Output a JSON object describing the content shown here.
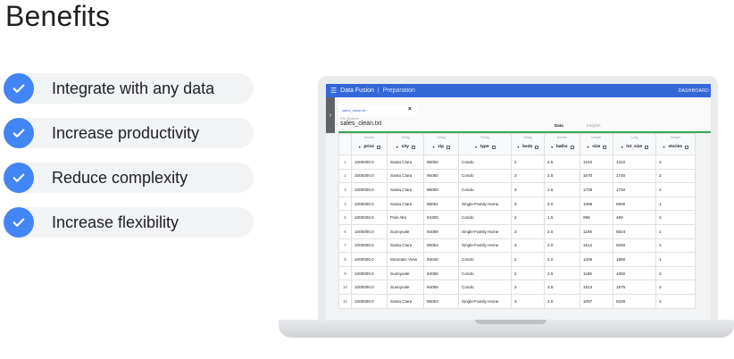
{
  "slide": {
    "title": "Benefits",
    "bullets": [
      "Integrate with any data",
      "Increase productivity",
      "Reduce complexity",
      "Increase flexibility"
    ],
    "bullet_icon": "check-icon",
    "colors": {
      "check": "#4285f4",
      "pill": "#f1f3f4"
    }
  },
  "app": {
    "name": "Data Fusion",
    "section": "Preparation",
    "dashboard_label": "DASHBOARD",
    "file_tab": "sales_clean.txt",
    "source": "File System",
    "dataset": "sales_clean.txt",
    "view_tabs": [
      "Data",
      "Insights"
    ],
    "active_view": "Data",
    "colors": {
      "topbar": "#3367d6",
      "accent_line": "#34a853"
    }
  },
  "table": {
    "columns": [
      {
        "type": "Double",
        "name": "price"
      },
      {
        "type": "String",
        "name": "city"
      },
      {
        "type": "String",
        "name": "zip"
      },
      {
        "type": "String",
        "name": "type"
      },
      {
        "type": "String",
        "name": "beds"
      },
      {
        "type": "Double",
        "name": "baths"
      },
      {
        "type": "Integer",
        "name": "size"
      },
      {
        "type": "Long",
        "name": "lot_size"
      },
      {
        "type": "Integer",
        "name": "stories"
      }
    ],
    "rows": [
      [
        "1",
        "1000000.0",
        "Santa Clara",
        "95050",
        "Condo",
        "2",
        "2.5",
        "1410",
        "1422",
        "3"
      ],
      [
        "2",
        "1000000.0",
        "Santa Clara",
        "95050",
        "Condo",
        "3",
        "2.5",
        "1670",
        "1740",
        "2"
      ],
      [
        "3",
        "1000000.0",
        "Santa Clara",
        "95050",
        "Condo",
        "3",
        "2.5",
        "1708",
        "1750",
        "2"
      ],
      [
        "4",
        "1000000.0",
        "Santa Clara",
        "95051",
        "Single-Family Home",
        "3",
        "2.0",
        "1068",
        "5600",
        "1"
      ],
      [
        "5",
        "1000000.0",
        "Palo Alto",
        "94306",
        "Condo",
        "2",
        "1.5",
        "998",
        "499",
        "2"
      ],
      [
        "6",
        "1000000.0",
        "Sunnyvale",
        "94089",
        "Single-Family Home",
        "3",
        "2.0",
        "1108",
        "5824",
        "1"
      ],
      [
        "7",
        "1000000.0",
        "Santa Clara",
        "95054",
        "Single-Family Home",
        "3",
        "2.0",
        "1612",
        "6250",
        "1"
      ],
      [
        "8",
        "1000000.0",
        "Mountain View",
        "94040",
        "Condo",
        "2",
        "2.0",
        "1206",
        "1880",
        "1"
      ],
      [
        "9",
        "1000000.0",
        "Sunnyvale",
        "94085",
        "Condo",
        "2",
        "2.5",
        "1196",
        "1082",
        "3"
      ],
      [
        "10",
        "1000000.0",
        "Sunnyvale",
        "94086",
        "Condo",
        "3",
        "3.5",
        "1513",
        "1575",
        "3"
      ],
      [
        "11",
        "1000000.0",
        "Santa Clara",
        "95054",
        "Single-Family Home",
        "3",
        "2.0",
        "1097",
        "6200",
        "1"
      ]
    ]
  }
}
